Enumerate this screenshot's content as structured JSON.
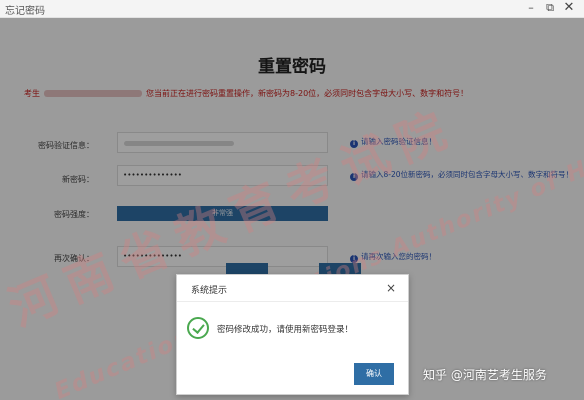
{
  "window": {
    "title": "忘记密码",
    "controls": {
      "minimize": "–",
      "maximize": "⧉",
      "close": "✕"
    }
  },
  "form": {
    "heading": "重置密码",
    "notice": {
      "prefix": "考生",
      "text": "您当前正在进行密码重置操作，新密码为8-20位，必须同时包含字母大小写、数字和符号！"
    },
    "fields": {
      "verify": {
        "label": "密码验证信息：",
        "value": "",
        "hint": "请输入密码验证信息！"
      },
      "new_password": {
        "label": "新密码：",
        "value": "••••••••••••••",
        "hint": "请输入8-20位新密码，必须同时包含字母大小写、数字和符号！"
      },
      "strength": {
        "label": "密码强度：",
        "value": "非常强"
      },
      "confirm": {
        "label": "再次确认：",
        "value": "••••••••••••••",
        "hint": "请再次输入您的密码！"
      }
    }
  },
  "dialog": {
    "title": "系统提示",
    "close": "×",
    "message": "密码修改成功，请使用新密码登录！",
    "confirm_label": "确认"
  },
  "watermark": {
    "big": "河南省教育考试院",
    "small": "Education Examinations Authority of HeNan Prov"
  },
  "attribution": "知乎 @河南艺考生服务",
  "colors": {
    "brand_blue": "#2f6ea5",
    "notice_red": "#c9201e",
    "hint_blue": "#2b55b8",
    "success_green": "#4aa84f"
  },
  "icons": [
    "info-icon",
    "check-circle-icon",
    "close-icon"
  ]
}
